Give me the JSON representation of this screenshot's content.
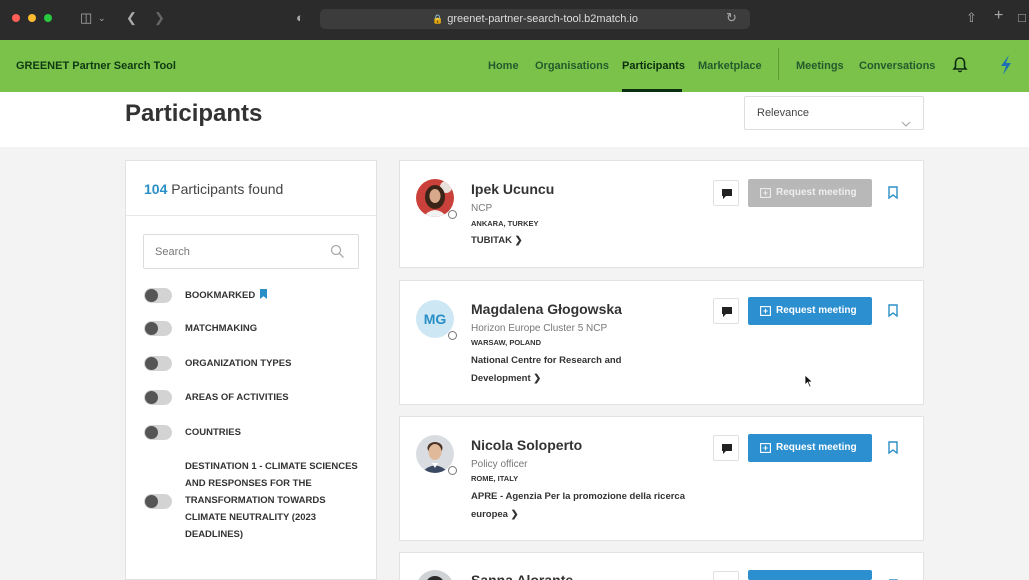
{
  "browser": {
    "url": "greenet-partner-search-tool.b2match.io",
    "traffic_colors": [
      "#ff5f57",
      "#febc2e",
      "#28c840"
    ]
  },
  "app": {
    "brand": "GREENET Partner Search Tool",
    "accent_green": "#7bc24b",
    "nav": {
      "home": "Home",
      "organisations": "Organisations",
      "participants": "Participants",
      "marketplace": "Marketplace",
      "meetings": "Meetings",
      "conversations": "Conversations"
    }
  },
  "page": {
    "title": "Participants",
    "sort_value": "Relevance"
  },
  "filters": {
    "count": "104",
    "found_label": "Participants found",
    "search_placeholder": "Search",
    "items": [
      "BOOKMARKED",
      "MATCHMAKING",
      "ORGANIZATION TYPES",
      "AREAS OF ACTIVITIES",
      "COUNTRIES",
      "DESTINATION 1 - CLIMATE SCIENCES AND RESPONSES FOR THE TRANSFORMATION TOWARDS CLIMATE NEUTRALITY (2023 DEADLINES)"
    ]
  },
  "participants": [
    {
      "name": "Ipek Ucuncu",
      "role": "NCP",
      "location": "ANKARA, TURKEY",
      "org": "TUBITAK",
      "request_label": "Request meeting",
      "request_enabled": false
    },
    {
      "name": "Magdalena Głogowska",
      "initials": "MG",
      "role": "Horizon Europe Cluster 5 NCP",
      "location": "WARSAW, POLAND",
      "org_line1": "National Centre for Research and",
      "org_line2": "Development",
      "request_label": "Request meeting",
      "request_enabled": true
    },
    {
      "name": "Nicola Soloperto",
      "role": "Policy officer",
      "location": "ROME, ITALY",
      "org_line1": "APRE - Agenzia Per la promozione della ricerca",
      "org_line2": "europea",
      "request_label": "Request meeting",
      "request_enabled": true
    },
    {
      "name": "Sanna Alorante",
      "request_enabled": true
    }
  ]
}
